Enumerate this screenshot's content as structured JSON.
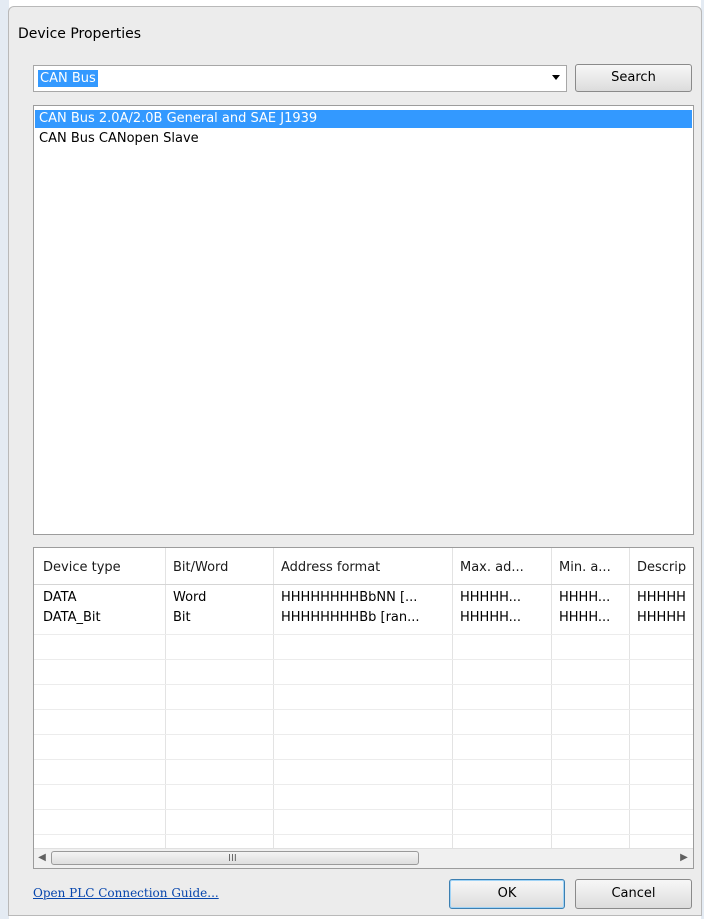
{
  "dialog": {
    "title": "Device Properties"
  },
  "search": {
    "value": "CAN Bus",
    "button_label": "Search"
  },
  "device_list": {
    "items": [
      {
        "label": "CAN Bus 2.0A/2.0B General and SAE J1939",
        "selected": true
      },
      {
        "label": "CAN Bus CANopen Slave",
        "selected": false
      }
    ]
  },
  "grid": {
    "columns": [
      "Device type",
      "Bit/Word",
      "Address format",
      "Max. ad...",
      "Min. a...",
      "Descrip"
    ],
    "rows": [
      [
        "DATA",
        "Word",
        "HHHHHHHHBbNN [...",
        "HHHHH...",
        "HHHH...",
        "HHHHH"
      ],
      [
        "DATA_Bit",
        "Bit",
        "HHHHHHHHBb [ran...",
        "HHHHH...",
        "HHHH...",
        "HHHHH"
      ]
    ],
    "scroll_grip": "III"
  },
  "footer": {
    "guide_link": "Open PLC Connection Guide...",
    "ok_label": "OK",
    "cancel_label": "Cancel"
  },
  "colors": {
    "selection": "#3399ff",
    "link": "#0645ad",
    "dialog_bg": "#ececec"
  }
}
